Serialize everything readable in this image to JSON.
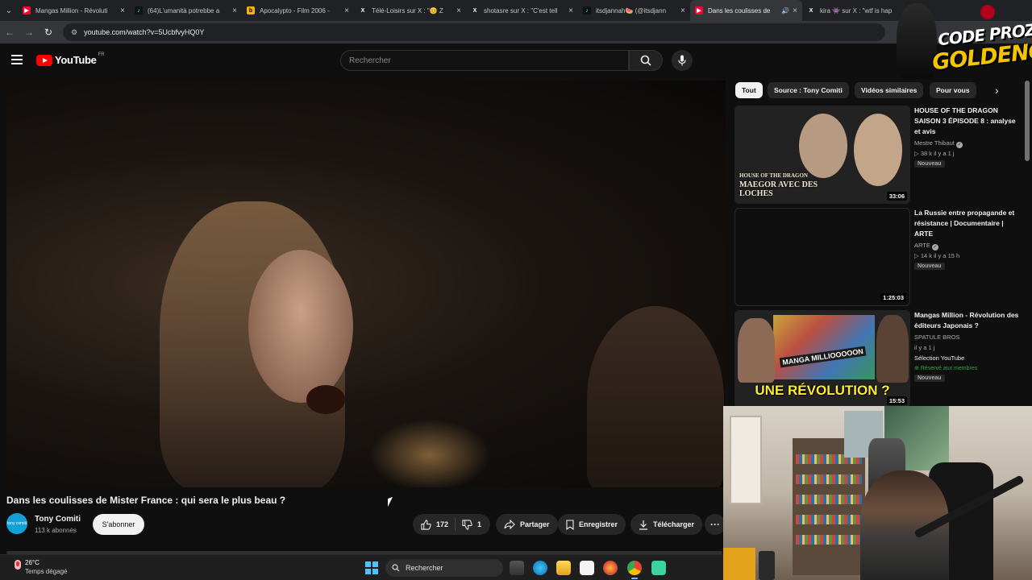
{
  "browser": {
    "tabs": [
      {
        "title": "Mangas Million - Révoluti",
        "favicon": "youtube",
        "color": "#ff0033"
      },
      {
        "title": "(64)L'umanità potrebbe a",
        "favicon": "tiktok",
        "color": "#111111"
      },
      {
        "title": "Apocalypto - Film 2006 -",
        "favicon": "google-sheets",
        "color": "#f4b400"
      },
      {
        "title": "Télé-Loisirs sur X : \"😊 Z",
        "favicon": "x",
        "color": "#000000"
      },
      {
        "title": "shotasre sur X : \"C'est tell",
        "favicon": "x",
        "color": "#000000"
      },
      {
        "title": "itsdjannah🍉 (@itsdjann",
        "favicon": "tiktok",
        "color": "#111111"
      },
      {
        "title": "Dans les coulisses de",
        "favicon": "youtube",
        "color": "#ff0033",
        "active": true
      },
      {
        "title": "kira 👾 sur X : \"wtf is hap",
        "favicon": "x",
        "color": "#000000"
      }
    ],
    "url": "youtube.com/watch?v=5UcbfvyHQ0Y"
  },
  "youtube": {
    "logo_text": "YouTube",
    "country_code": "FR",
    "search_placeholder": "Rechercher"
  },
  "video": {
    "title": "Dans les coulisses de Mister France : qui sera le plus beau ?",
    "channel": "Tony Comiti",
    "channel_avatar_text": "tony comiti",
    "subscribers": "113 k abonnés",
    "subscribe_label": "S'abonner",
    "likes": "172",
    "dislikes": "1",
    "share_label": "Partager",
    "save_label": "Enregistrer",
    "download_label": "Télécharger"
  },
  "chips": [
    "Tout",
    "Source : Tony Comiti",
    "Vidéos similaires",
    "Pour vous"
  ],
  "recommendations": [
    {
      "title": "HOUSE OF THE DRAGON SAISON 3 ÉPISODE 8 : analyse et avis",
      "channel": "Mestre Thibaut",
      "verified": true,
      "views_time": "▷ 38 k  il y a 1 j",
      "badge": "Nouveau",
      "duration": "33:06",
      "thumb_text_top": "HOUSE OF THE DRAGON",
      "thumb_text_main": "MAEGOR AVEC DES LOCHES"
    },
    {
      "title": "La Russie entre propagande et résistance | Documentaire | ARTE",
      "channel": "ARTE",
      "verified": true,
      "views_time": "▷ 14 k  il y a 15 h",
      "badge": "Nouveau",
      "duration": "1:25:03"
    },
    {
      "title": "Mangas Million - Révolution des éditeurs Japonais ?",
      "channel": "SPATULE BROS",
      "views_time": "il y a 1 j",
      "selection": "Sélection YouTube",
      "members": "Réservé aux membres",
      "badge": "Nouveau",
      "duration": "15:53",
      "thumb_text_small": "MANGA MILLIOOOOON",
      "thumb_text_main": "UNE RÉVOLUTION ?"
    }
  ],
  "overlay": {
    "line1": "CODE PROZIS",
    "line2": "GOLDENG"
  },
  "taskbar": {
    "temperature": "26°C",
    "weather": "Temps dégagé",
    "search_label": "Rechercher"
  }
}
